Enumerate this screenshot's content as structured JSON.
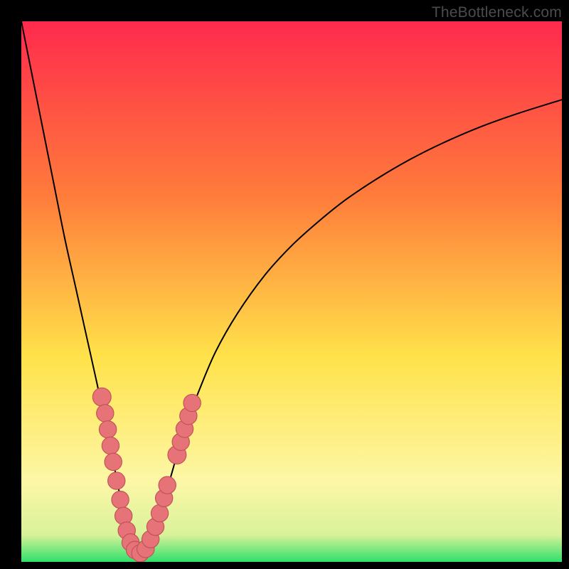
{
  "watermark": "TheBottleneck.com",
  "colors": {
    "frame": "#000000",
    "gradient_top": "#ff2a4d",
    "gradient_mid_upper": "#ff7b3b",
    "gradient_mid": "#ffe24a",
    "gradient_lower": "#fdf7a6",
    "gradient_green": "#2fe06a",
    "curve": "#000000",
    "marker_fill": "#e57377",
    "marker_stroke": "#c25058"
  },
  "chart_data": {
    "type": "line",
    "title": "",
    "xlabel": "",
    "ylabel": "",
    "xlim": [
      0,
      100
    ],
    "ylim": [
      0,
      100
    ],
    "series": [
      {
        "name": "left-curve",
        "x": [
          0,
          2,
          4,
          6,
          8,
          10,
          12,
          14,
          15,
          16,
          17,
          18,
          18.7,
          19.3,
          20,
          21,
          22
        ],
        "y": [
          100,
          90,
          80,
          70,
          60,
          51,
          42,
          33,
          28,
          23.5,
          18.5,
          13.5,
          9.5,
          6.5,
          4,
          2,
          1.3
        ]
      },
      {
        "name": "right-curve",
        "x": [
          22,
          24,
          26,
          28,
          30,
          33,
          36,
          40,
          45,
          50,
          55,
          60,
          66,
          72,
          78,
          85,
          92,
          100
        ],
        "y": [
          1.3,
          4,
          10,
          17,
          24,
          32,
          39,
          46,
          53,
          58.5,
          63,
          67,
          71,
          74.5,
          77.5,
          80.5,
          83,
          85.5
        ]
      }
    ],
    "markers": [
      {
        "x": 14.9,
        "y": 30.5,
        "r": 1.7
      },
      {
        "x": 15.5,
        "y": 27.5,
        "r": 1.6
      },
      {
        "x": 16.0,
        "y": 24.5,
        "r": 1.6
      },
      {
        "x": 16.5,
        "y": 21.5,
        "r": 1.6
      },
      {
        "x": 17.0,
        "y": 18.5,
        "r": 1.6
      },
      {
        "x": 17.6,
        "y": 15.0,
        "r": 1.6
      },
      {
        "x": 18.3,
        "y": 11.5,
        "r": 1.6
      },
      {
        "x": 18.9,
        "y": 8.5,
        "r": 1.6
      },
      {
        "x": 19.5,
        "y": 5.8,
        "r": 1.6
      },
      {
        "x": 20.2,
        "y": 3.6,
        "r": 1.6
      },
      {
        "x": 21.0,
        "y": 2.2,
        "r": 1.6
      },
      {
        "x": 22.0,
        "y": 1.6,
        "r": 1.6
      },
      {
        "x": 23.0,
        "y": 2.4,
        "r": 1.6
      },
      {
        "x": 23.9,
        "y": 4.2,
        "r": 1.6
      },
      {
        "x": 24.8,
        "y": 6.5,
        "r": 1.6
      },
      {
        "x": 25.6,
        "y": 9.0,
        "r": 1.6
      },
      {
        "x": 26.4,
        "y": 11.8,
        "r": 1.6
      },
      {
        "x": 27.0,
        "y": 14.2,
        "r": 1.6
      },
      {
        "x": 28.8,
        "y": 19.8,
        "r": 1.7
      },
      {
        "x": 29.5,
        "y": 22.2,
        "r": 1.6
      },
      {
        "x": 30.2,
        "y": 24.6,
        "r": 1.6
      },
      {
        "x": 30.9,
        "y": 27.0,
        "r": 1.6
      },
      {
        "x": 31.6,
        "y": 29.4,
        "r": 1.6
      }
    ]
  }
}
